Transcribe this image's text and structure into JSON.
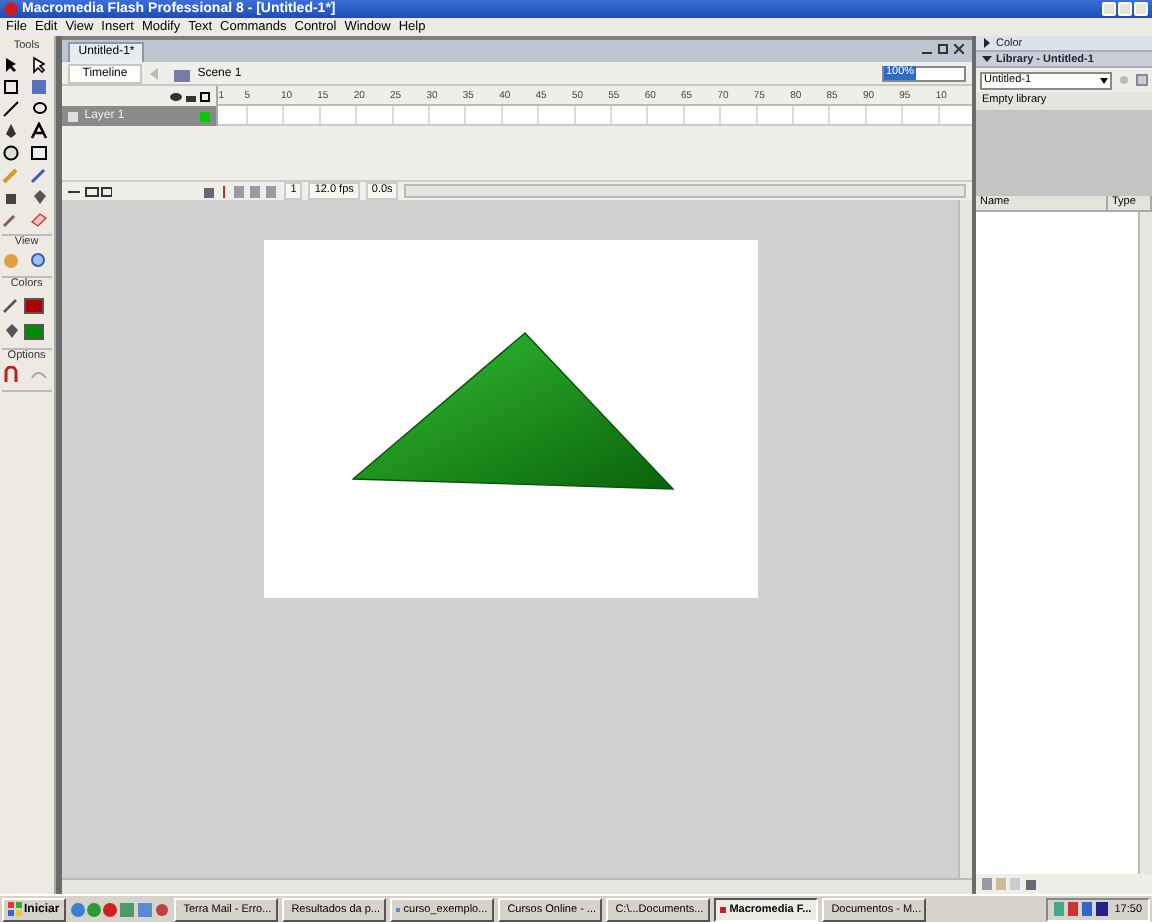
{
  "window": {
    "title": "Macromedia Flash Professional 8 - [Untitled-1*]"
  },
  "menu": [
    "File",
    "Edit",
    "View",
    "Insert",
    "Modify",
    "Text",
    "Commands",
    "Control",
    "Window",
    "Help"
  ],
  "tools": {
    "title": "Tools",
    "sections": [
      "View",
      "Colors",
      "Options"
    ],
    "colors": [
      {
        "kind": "stroke",
        "color": "#aa0000"
      },
      {
        "kind": "fill",
        "color": "#008a00"
      }
    ]
  },
  "document": {
    "tab": "Untitled-1*",
    "timeline_button": "Timeline",
    "scene": "Scene 1",
    "zoom": "100%",
    "frame_numbers": [
      "1",
      "5",
      "10",
      "15",
      "20",
      "25",
      "30",
      "35",
      "40",
      "45",
      "50",
      "55",
      "60",
      "65",
      "70",
      "75",
      "80",
      "85",
      "90",
      "95",
      "10"
    ],
    "layers": [
      {
        "name": "Layer 1",
        "selected": true
      }
    ],
    "status": {
      "frame": "1",
      "fps": "12.0 fps",
      "time": "0.0s"
    }
  },
  "panels": [
    {
      "kind": "color",
      "title": "Color",
      "expanded": false
    },
    {
      "kind": "library",
      "title": "Library - Untitled-1",
      "expanded": true,
      "document": "Untitled-1",
      "status": "Empty library",
      "columns": [
        "Name",
        "Type"
      ]
    }
  ],
  "taskbar": {
    "start": "Iniciar",
    "tasks": [
      {
        "label": "Terra Mail - Erro...",
        "selected": false
      },
      {
        "label": "Resultados da p...",
        "selected": false
      },
      {
        "label": "curso_exemplo...",
        "selected": false
      },
      {
        "label": "Cursos Online - ...",
        "selected": false
      },
      {
        "label": "C:\\...Documents...",
        "selected": false
      },
      {
        "label": "Macromedia F...",
        "selected": true
      },
      {
        "label": "Documentos - M...",
        "selected": false
      }
    ],
    "clock": "17:50"
  }
}
